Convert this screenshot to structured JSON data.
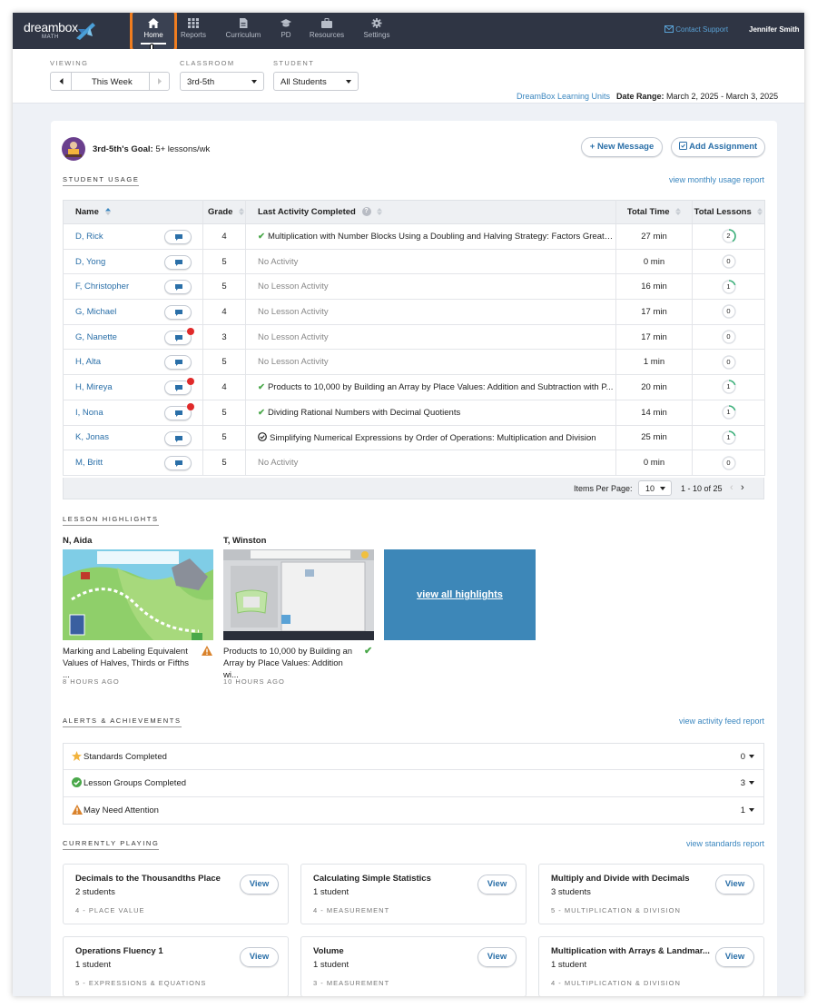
{
  "nav": {
    "logo": {
      "word": "dreambox",
      "sub": "MATH"
    },
    "items": [
      {
        "label": "Home",
        "icon": "home-icon"
      },
      {
        "label": "Reports",
        "icon": "grid-icon"
      },
      {
        "label": "Curriculum",
        "icon": "document-icon"
      },
      {
        "label": "PD",
        "icon": "graduation-cap-icon"
      },
      {
        "label": "Resources",
        "icon": "briefcase-icon"
      },
      {
        "label": "Settings",
        "icon": "gear-icon"
      }
    ],
    "contact_support": "Contact Support",
    "user_name": "Jennifer Smith"
  },
  "filters": {
    "viewing_label": "VIEWING",
    "viewing_value": "This Week",
    "classroom_label": "CLASSROOM",
    "classroom_value": "3rd-5th",
    "student_label": "STUDENT",
    "student_value": "All Students",
    "learning_units_link": "DreamBox Learning Units",
    "date_range_label": "Date Range:",
    "date_range_value": "March 2, 2025 - March 3, 2025"
  },
  "goal": {
    "label": "3rd-5th's Goal:",
    "value": "5+ lessons/wk"
  },
  "actions": {
    "new_message": "New Message",
    "add_assignment": "Add Assignment"
  },
  "usage": {
    "title": "STUDENT USAGE",
    "report_link": "view monthly usage report",
    "columns": {
      "name": "Name",
      "grade": "Grade",
      "activity": "Last Activity Completed",
      "time": "Total Time",
      "lessons": "Total Lessons"
    },
    "rows": [
      {
        "name": "D, Rick",
        "grade": "4",
        "activity": "Multiplication with Number Blocks Using a Doubling and Halving Strategy: Factors Greate...",
        "status": "done",
        "time": "27 min",
        "lessons": "2",
        "alert": false
      },
      {
        "name": "D, Yong",
        "grade": "5",
        "activity": "No Activity",
        "status": "none",
        "time": "0 min",
        "lessons": "0",
        "alert": false
      },
      {
        "name": "F, Christopher",
        "grade": "5",
        "activity": "No Lesson Activity",
        "status": "none",
        "time": "16 min",
        "lessons": "1",
        "alert": false
      },
      {
        "name": "G, Michael",
        "grade": "4",
        "activity": "No Lesson Activity",
        "status": "none",
        "time": "17 min",
        "lessons": "0",
        "alert": false
      },
      {
        "name": "G, Nanette",
        "grade": "3",
        "activity": "No Lesson Activity",
        "status": "none",
        "time": "17 min",
        "lessons": "0",
        "alert": true
      },
      {
        "name": "H, Alta",
        "grade": "5",
        "activity": "No Lesson Activity",
        "status": "none",
        "time": "1 min",
        "lessons": "0",
        "alert": false
      },
      {
        "name": "H, Mireya",
        "grade": "4",
        "activity": "Products to 10,000 by Building an Array by Place Values: Addition and Subtraction with P...",
        "status": "done",
        "time": "20 min",
        "lessons": "1",
        "alert": true
      },
      {
        "name": "I, Nona",
        "grade": "5",
        "activity": "Dividing Rational Numbers with Decimal Quotients",
        "status": "done",
        "time": "14 min",
        "lessons": "1",
        "alert": true
      },
      {
        "name": "K, Jonas",
        "grade": "5",
        "activity": "Simplifying Numerical Expressions by Order of Operations: Multiplication and Division",
        "status": "circle",
        "time": "25 min",
        "lessons": "1",
        "alert": false
      },
      {
        "name": "M, Britt",
        "grade": "5",
        "activity": "No Activity",
        "status": "none",
        "time": "0 min",
        "lessons": "0",
        "alert": false
      }
    ],
    "pager": {
      "label": "Items Per Page:",
      "per_page": "10",
      "range": "1 - 10 of 25"
    }
  },
  "highlights": {
    "title": "LESSON HIGHLIGHTS",
    "items": [
      {
        "student": "N, Aida",
        "title": "Marking and Labeling Equivalent Values of Halves, Thirds or Fifths ...",
        "time": "8 HOURS AGO",
        "status": "warning"
      },
      {
        "student": "T, Winston",
        "title": "Products to 10,000 by Building an Array by Place Values: Addition wi...",
        "time": "10 HOURS AGO",
        "status": "done"
      }
    ],
    "view_all": "view all highlights"
  },
  "alerts": {
    "title": "ALERTS & ACHIEVEMENTS",
    "report_link": "view activity feed report",
    "rows": [
      {
        "label": "Standards Completed",
        "count": "0",
        "icon": "star-icon"
      },
      {
        "label": "Lesson Groups Completed",
        "count": "3",
        "icon": "check-circle-icon"
      },
      {
        "label": "May Need Attention",
        "count": "1",
        "icon": "warning-icon"
      }
    ]
  },
  "playing": {
    "title": "CURRENTLY PLAYING",
    "report_link": "view standards report",
    "view_label": "View",
    "cards": [
      {
        "title": "Decimals to the Thousandths Place",
        "students": "2 students",
        "category": "4 - PLACE VALUE"
      },
      {
        "title": "Calculating Simple Statistics",
        "students": "1 student",
        "category": "4 - MEASUREMENT"
      },
      {
        "title": "Multiply and Divide with Decimals",
        "students": "3 students",
        "category": "5 - MULTIPLICATION & DIVISION"
      },
      {
        "title": "Operations Fluency 1",
        "students": "1 student",
        "category": "5 - EXPRESSIONS & EQUATIONS"
      },
      {
        "title": "Volume",
        "students": "1 student",
        "category": "3 - MEASUREMENT"
      },
      {
        "title": "Multiplication with Arrays & Landmar...",
        "students": "1 student",
        "category": "4 - MULTIPLICATION & DIVISION"
      }
    ]
  },
  "colors": {
    "nav_bg": "#2f3544",
    "accent_blue": "#2a6fa8",
    "highlight_orange": "#f07d1f",
    "success_green": "#4aa84a",
    "alert_red": "#e02a2a"
  }
}
